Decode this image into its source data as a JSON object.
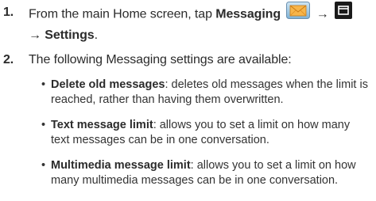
{
  "steps": [
    {
      "number": "1.",
      "text_before": "From the main Home screen, tap ",
      "bold_1": "Messaging",
      "arrow_1": " → ",
      "line_2": "→ Settings",
      "line_2_end": "."
    },
    {
      "number": "2.",
      "text": "The following Messaging settings are available:"
    }
  ],
  "bullets": [
    {
      "symbol": "•",
      "term": "Delete old messages",
      "description": ": deletes old messages when the limit is reached, rather than having them overwritten."
    },
    {
      "symbol": "•",
      "term": "Text message limit",
      "description": ": allows you to set a limit on how many text messages can be in one conversation."
    },
    {
      "symbol": "•",
      "term": "Multimedia message limit",
      "description": ": allows you to set a limit on how many multimedia messages can be in one conversation."
    }
  ],
  "icons": {
    "messaging": "messaging-envelope-icon",
    "menu": "menu-key-icon"
  },
  "colors": {
    "text": "#2b2b2b",
    "envelope_fill": "#f2a33a",
    "menu_key": "#1a1a1a"
  }
}
